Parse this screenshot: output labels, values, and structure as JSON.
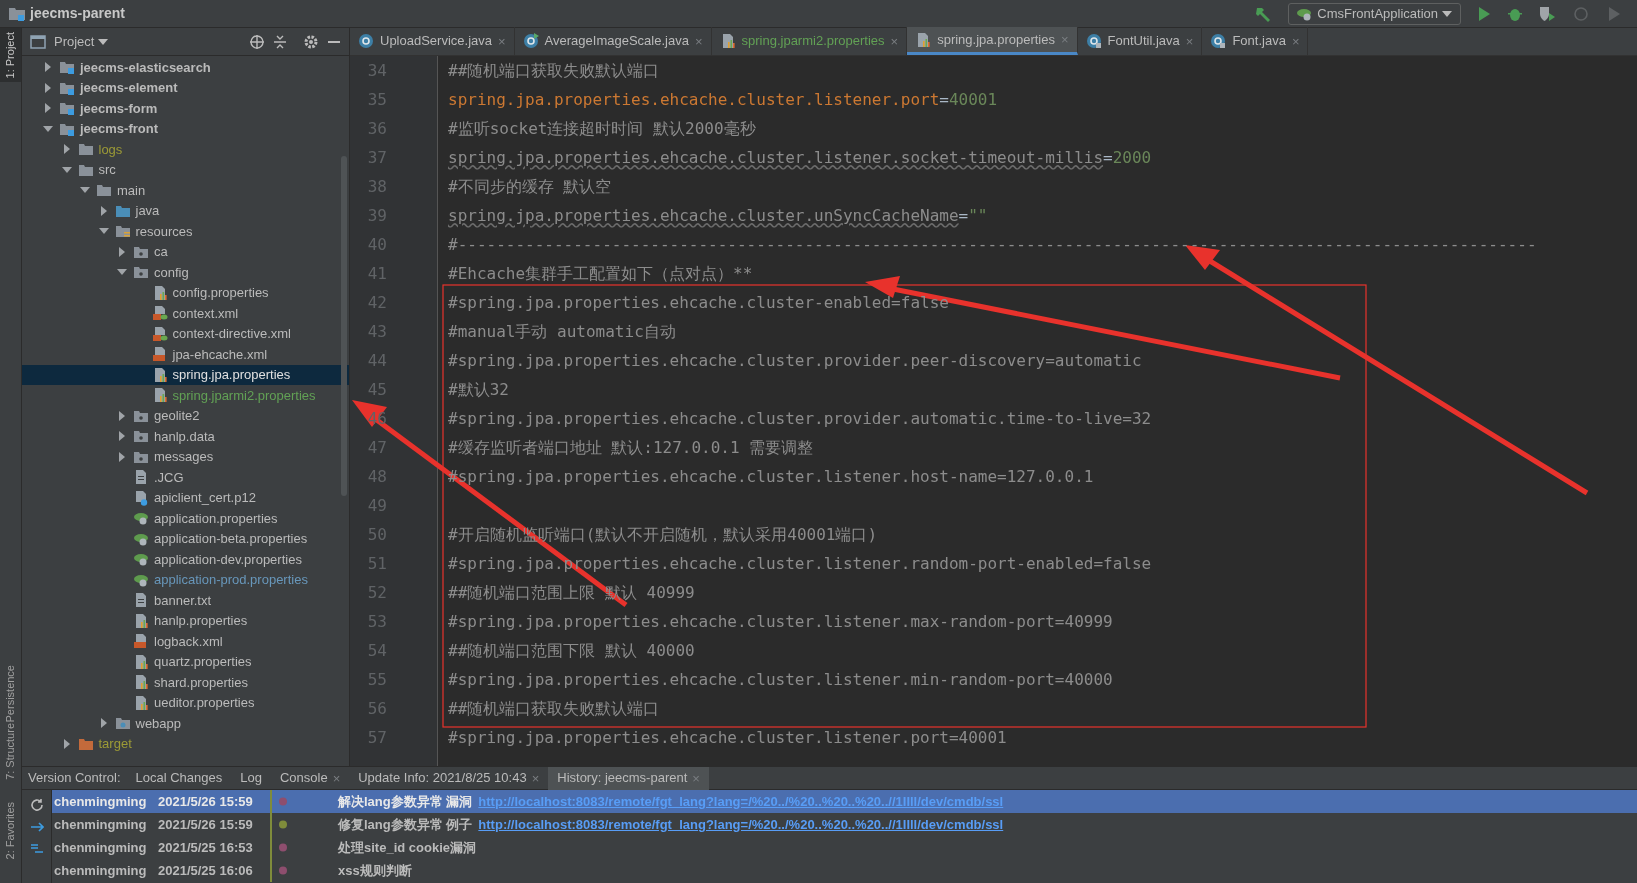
{
  "window": {
    "title": "jeecms-parent"
  },
  "toolbar": {
    "run_config": "CmsFrontApplication"
  },
  "side_strip": {
    "top": "1: Project",
    "middle": [
      "Persistence",
      "7: Structure"
    ],
    "bottom": "2: Favorites"
  },
  "project_panel": {
    "title": "Project",
    "tree": [
      {
        "label": "jeecms-elasticsearch",
        "kind": "module",
        "color": "#bbbbbb",
        "selected": false,
        "expanded": false
      },
      {
        "label": "jeecms-element",
        "kind": "module",
        "color": "#bbbbbb",
        "selected": false,
        "expanded": false
      },
      {
        "label": "jeecms-form",
        "kind": "module",
        "color": "#bbbbbb",
        "selected": false,
        "expanded": false
      },
      {
        "label": "jeecms-front",
        "kind": "module",
        "color": "#bbbbbb",
        "selected": false,
        "expanded": true,
        "children": [
          {
            "label": "logs",
            "kind": "folder",
            "color": "#9c9a36",
            "selected": false,
            "expanded": false
          },
          {
            "label": "src",
            "kind": "folder",
            "color": "#bbbbbb",
            "selected": false,
            "expanded": true,
            "children": [
              {
                "label": "main",
                "kind": "folder",
                "color": "#bbbbbb",
                "selected": false,
                "expanded": true,
                "children": [
                  {
                    "label": "java",
                    "kind": "source-folder",
                    "color": "#bbbbbb",
                    "selected": false,
                    "expanded": false
                  },
                  {
                    "label": "resources",
                    "kind": "resources-folder",
                    "color": "#bbbbbb",
                    "selected": false,
                    "expanded": true,
                    "children": [
                      {
                        "label": "ca",
                        "kind": "package-folder",
                        "color": "#bbbbbb",
                        "selected": false,
                        "expanded": false
                      },
                      {
                        "label": "config",
                        "kind": "package-folder",
                        "color": "#bbbbbb",
                        "selected": false,
                        "expanded": true,
                        "children": [
                          {
                            "label": "config.properties",
                            "kind": "properties",
                            "color": "#bbbbbb",
                            "selected": false
                          },
                          {
                            "label": "context.xml",
                            "kind": "spring-xml",
                            "color": "#bbbbbb",
                            "selected": false
                          },
                          {
                            "label": "context-directive.xml",
                            "kind": "spring-xml",
                            "color": "#bbbbbb",
                            "selected": false
                          },
                          {
                            "label": "jpa-ehcache.xml",
                            "kind": "xml",
                            "color": "#bbbbbb",
                            "selected": false
                          },
                          {
                            "label": "spring.jpa.properties",
                            "kind": "properties",
                            "selected": true
                          },
                          {
                            "label": "spring.jparmi2.properties",
                            "kind": "properties",
                            "color": "#62a155",
                            "selected": false
                          }
                        ]
                      },
                      {
                        "label": "geolite2",
                        "kind": "package-folder",
                        "color": "#bbbbbb",
                        "selected": false,
                        "expanded": false
                      },
                      {
                        "label": "hanlp.data",
                        "kind": "package-folder",
                        "color": "#bbbbbb",
                        "selected": false,
                        "expanded": false
                      },
                      {
                        "label": "messages",
                        "kind": "package-folder",
                        "color": "#bbbbbb",
                        "selected": false,
                        "expanded": false
                      },
                      {
                        "label": ".JCG",
                        "kind": "text",
                        "color": "#bbbbbb",
                        "selected": false
                      },
                      {
                        "label": "apiclient_cert.p12",
                        "kind": "unknown",
                        "color": "#bbbbbb",
                        "selected": false
                      },
                      {
                        "label": "application.properties",
                        "kind": "spring-boot",
                        "color": "#bbbbbb",
                        "selected": false
                      },
                      {
                        "label": "application-beta.properties",
                        "kind": "spring-boot",
                        "color": "#bbbbbb",
                        "selected": false
                      },
                      {
                        "label": "application-dev.properties",
                        "kind": "spring-boot",
                        "color": "#bbbbbb",
                        "selected": false
                      },
                      {
                        "label": "application-prod.properties",
                        "kind": "spring-boot",
                        "color": "#6897bb",
                        "selected": false
                      },
                      {
                        "label": "banner.txt",
                        "kind": "text",
                        "color": "#bbbbbb",
                        "selected": false
                      },
                      {
                        "label": "hanlp.properties",
                        "kind": "properties",
                        "color": "#bbbbbb",
                        "selected": false
                      },
                      {
                        "label": "logback.xml",
                        "kind": "xml",
                        "color": "#bbbbbb",
                        "selected": false
                      },
                      {
                        "label": "quartz.properties",
                        "kind": "properties",
                        "color": "#bbbbbb",
                        "selected": false
                      },
                      {
                        "label": "shard.properties",
                        "kind": "properties",
                        "color": "#bbbbbb",
                        "selected": false
                      },
                      {
                        "label": "ueditor.properties",
                        "kind": "properties",
                        "color": "#bbbbbb",
                        "selected": false
                      }
                    ]
                  },
                  {
                    "label": "webapp",
                    "kind": "web-folder",
                    "color": "#bbbbbb",
                    "selected": false,
                    "expanded": false
                  }
                ]
              }
            ]
          },
          {
            "label": "target",
            "kind": "excluded-folder",
            "color": "#9c9a36",
            "selected": false,
            "expanded": false
          }
        ]
      }
    ]
  },
  "editor_tabs": [
    {
      "label": "UploadService.java",
      "kind": "class",
      "color": "#bbbbbb",
      "close": "×",
      "selected": false
    },
    {
      "label": "AverageImageScale.java",
      "kind": "runnable-class",
      "color": "#bbbbbb",
      "close": "×",
      "selected": false
    },
    {
      "label": "spring.jparmi2.properties",
      "kind": "properties",
      "color": "#62a155",
      "close": "×",
      "selected": false
    },
    {
      "label": "spring.jpa.properties",
      "kind": "properties",
      "color": "#bbbbbb",
      "close": "×",
      "selected": true
    },
    {
      "label": "FontUtil.java",
      "kind": "locked-class",
      "color": "#bbbbbb",
      "close": "×",
      "selected": false
    },
    {
      "label": "Font.java",
      "kind": "locked-class",
      "color": "#bbbbbb",
      "close": "×",
      "selected": false
    }
  ],
  "editor_lines": [
    {
      "number": "34",
      "kind": "comment",
      "text": "##随机端口获取失败默认端口"
    },
    {
      "number": "35",
      "kind": "property",
      "key": "spring.jpa.properties.ehcache.cluster.listener.port",
      "separator": "=",
      "value": "40001",
      "unresolved": false
    },
    {
      "number": "36",
      "kind": "comment",
      "text": "#监听socket连接超时时间 默认2000毫秒"
    },
    {
      "number": "37",
      "kind": "property",
      "key": "spring.jpa.properties.ehcache.cluster.listener.socket-timeout-millis",
      "separator": "=",
      "value": "2000",
      "unresolved": true
    },
    {
      "number": "38",
      "kind": "comment",
      "text": "#不同步的缓存 默认空"
    },
    {
      "number": "39",
      "kind": "property",
      "key": "spring.jpa.properties.ehcache.cluster.unSyncCacheName",
      "separator": "=",
      "value": "\"\"",
      "unresolved": true
    },
    {
      "number": "40",
      "kind": "comment",
      "text": "#----------------------------------------------------------------------------------------------------------------"
    },
    {
      "number": "41",
      "kind": "comment",
      "text": "#Ehcache集群手工配置如下（点对点）**"
    },
    {
      "number": "42",
      "kind": "comment",
      "text": "#spring.jpa.properties.ehcache.cluster-enabled=false"
    },
    {
      "number": "43",
      "kind": "comment",
      "text": "#manual手动  automatic自动"
    },
    {
      "number": "44",
      "kind": "comment",
      "text": "#spring.jpa.properties.ehcache.cluster.provider.peer-discovery=automatic"
    },
    {
      "number": "45",
      "kind": "comment",
      "text": "#默认32"
    },
    {
      "number": "46",
      "kind": "comment",
      "text": "#spring.jpa.properties.ehcache.cluster.provider.automatic.time-to-live=32"
    },
    {
      "number": "47",
      "kind": "comment",
      "text": "#缓存监听者端口地址 默认:127.0.0.1 需要调整"
    },
    {
      "number": "48",
      "kind": "comment",
      "text": "#spring.jpa.properties.ehcache.cluster.listener.host-name=127.0.0.1"
    },
    {
      "number": "49",
      "kind": "blank"
    },
    {
      "number": "50",
      "kind": "comment",
      "text": "#开启随机监听端口(默认不开启随机，默认采用40001端口)"
    },
    {
      "number": "51",
      "kind": "comment",
      "text": "#spring.jpa.properties.ehcache.cluster.listener.random-port-enabled=false"
    },
    {
      "number": "52",
      "kind": "comment",
      "text": "##随机端口范围上限 默认 40999"
    },
    {
      "number": "53",
      "kind": "comment",
      "text": "#spring.jpa.properties.ehcache.cluster.listener.max-random-port=40999"
    },
    {
      "number": "54",
      "kind": "comment",
      "text": "##随机端口范围下限 默认 40000"
    },
    {
      "number": "55",
      "kind": "comment",
      "text": "#spring.jpa.properties.ehcache.cluster.listener.min-random-port=40000"
    },
    {
      "number": "56",
      "kind": "comment",
      "text": "##随机端口获取失败默认端口"
    },
    {
      "number": "57",
      "kind": "comment",
      "text": "#spring.jpa.properties.ehcache.cluster.listener.port=40001"
    }
  ],
  "bottom_panel": {
    "label": "Version Control:",
    "tabs": [
      {
        "label": "Local Changes",
        "selected": false
      },
      {
        "label": "Log",
        "selected": false
      },
      {
        "label": "Console",
        "close": "×",
        "selected": false
      },
      {
        "label": "Update Info: 2021/8/25 10:43",
        "close": "×",
        "selected": false
      },
      {
        "label": "History: jeecms-parent",
        "close": "×",
        "selected": true
      }
    ],
    "history": [
      {
        "author": "chenmingming",
        "date": "2021/5/26 15:59",
        "color": "#8e4e6e",
        "message": "解决lang参数异常 漏洞",
        "link": "http://localhost:8083/remote/fgt_lang?lang=/%20../%20..%20..%20..//1IIll/dev/cmdb/ssl",
        "selected": true
      },
      {
        "author": "chenmingming",
        "date": "2021/5/26 15:59",
        "color": "#7f8c3b",
        "message": "修复lang参数异常 例子",
        "link": "http://localhost:8083/remote/fgt_lang?lang=/%20../%20..%20..%20..//1IIll/dev/cmdb/ssl",
        "selected": false
      },
      {
        "author": "chenmingming",
        "date": "2021/5/25 16:53",
        "color": "#8e4e6e",
        "message": "处理site_id cookie漏洞",
        "selected": false
      },
      {
        "author": "chenmingming",
        "date": "2021/5/25 16:06",
        "color": "#8e4e6e",
        "message": "xss规则判断",
        "selected": false
      }
    ]
  }
}
